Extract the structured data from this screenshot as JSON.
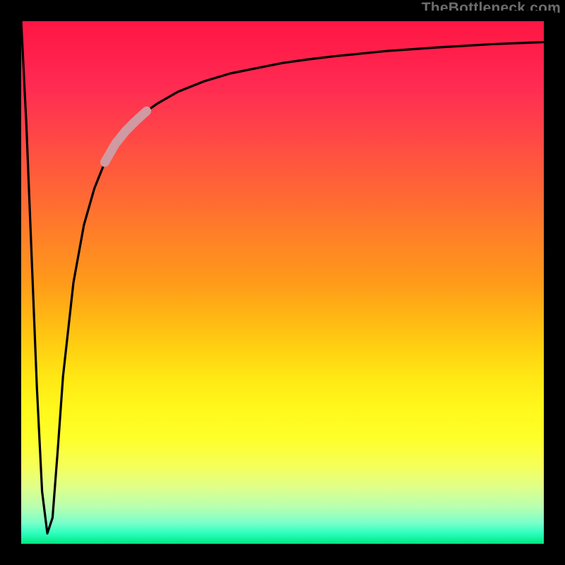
{
  "watermark": {
    "text": "TheBottleneck.com"
  },
  "chart_data": {
    "type": "line",
    "title": "",
    "xlabel": "",
    "ylabel": "",
    "xlim": [
      0,
      100
    ],
    "ylim": [
      0,
      100
    ],
    "grid": false,
    "description": "Bottleneck percentage curve over a red→green vertical gradient. Sharp dip to ~0 near x≈5 (optimal, green), rising steeply then asymptotically toward ~96 (severe bottleneck, red).",
    "series": [
      {
        "name": "bottleneck-curve",
        "x": [
          0,
          1,
          2,
          3,
          4,
          5,
          6,
          7,
          8,
          10,
          12,
          14,
          16,
          18,
          20,
          22,
          24,
          26,
          30,
          35,
          40,
          45,
          50,
          55,
          60,
          70,
          80,
          90,
          100
        ],
        "y": [
          100,
          80,
          55,
          30,
          10,
          2,
          5,
          18,
          32,
          50,
          61,
          68,
          73,
          76.5,
          79,
          81,
          82.8,
          84.2,
          86.5,
          88.5,
          90,
          91,
          92,
          92.7,
          93.3,
          94.3,
          95,
          95.6,
          96
        ]
      }
    ],
    "highlight_segment": {
      "name": "highlight-band",
      "color": "#cf9aa1",
      "x_start": 16,
      "x_end": 24,
      "note": "Thick pink overlay on curve between roughly x=16 and x=24"
    },
    "background_gradient": {
      "direction": "vertical",
      "stops": [
        {
          "pos": 0.0,
          "color": "#ff1744",
          "meaning": "worst"
        },
        {
          "pos": 0.5,
          "color": "#ff9a1a"
        },
        {
          "pos": 0.75,
          "color": "#fff81b"
        },
        {
          "pos": 1.0,
          "color": "#00e680",
          "meaning": "best"
        }
      ]
    }
  }
}
